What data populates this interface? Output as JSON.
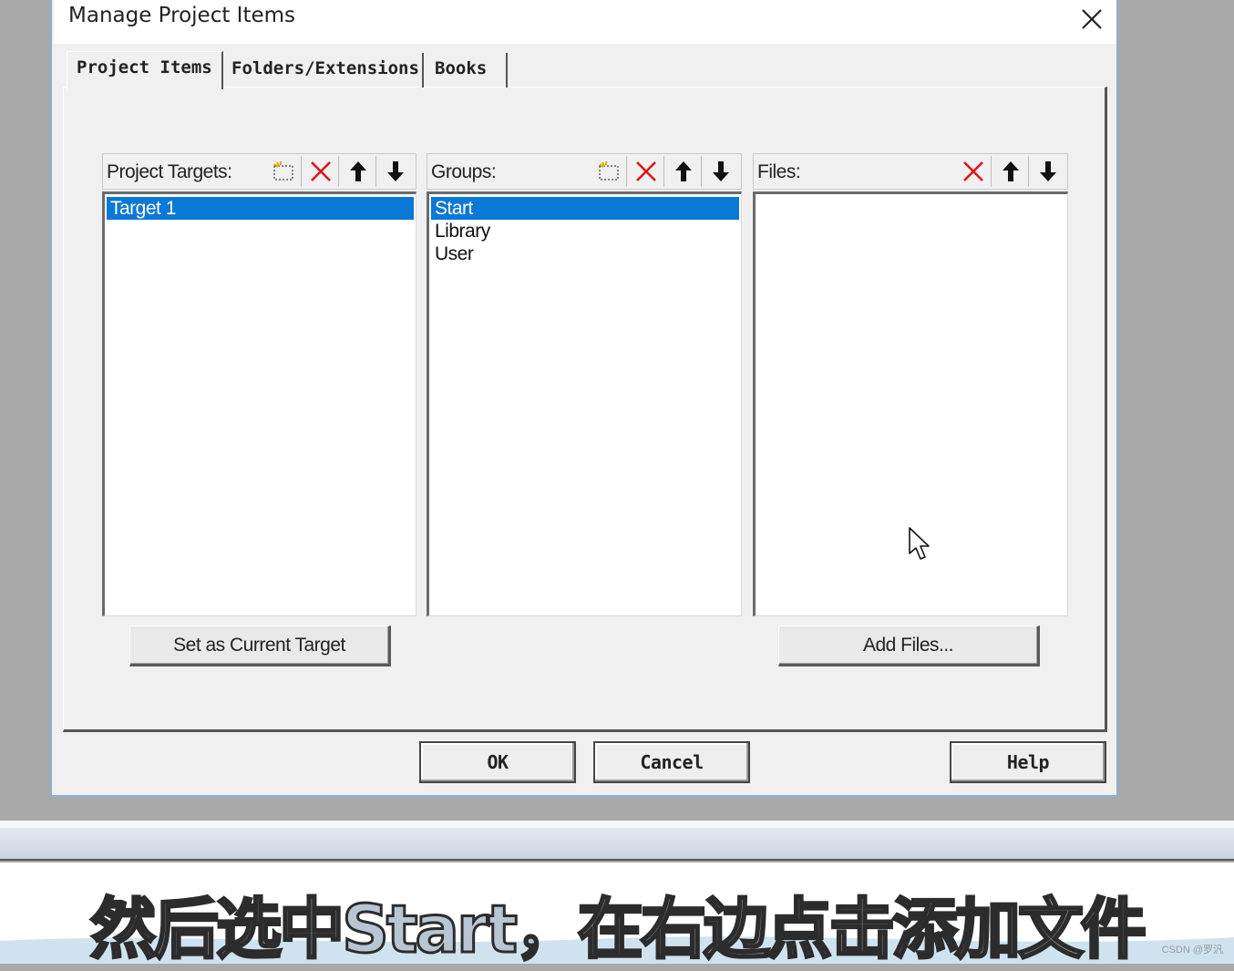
{
  "dialog": {
    "title": "Manage Project Items",
    "tabs": [
      "Project Items",
      "Folders/Extensions",
      "Books"
    ],
    "active_tab": "Project Items"
  },
  "targets_panel": {
    "label": "Project Targets:",
    "items": [
      "Target 1"
    ],
    "selected_index": 0,
    "button_label": "Set as Current Target"
  },
  "groups_panel": {
    "label": "Groups:",
    "items": [
      "Start",
      "Library",
      "User"
    ],
    "selected_index": 0
  },
  "files_panel": {
    "label": "Files:",
    "items": [],
    "button_label": "Add Files..."
  },
  "footer": {
    "ok": "OK",
    "cancel": "Cancel",
    "help": "Help"
  },
  "subtitle": "然后选中Start，在右边点击添加文件",
  "watermark": "CSDN @罗汎",
  "colors": {
    "selection": "#0a78d7",
    "delete_icon": "#e0141c",
    "window_border": "#8aaed6"
  }
}
